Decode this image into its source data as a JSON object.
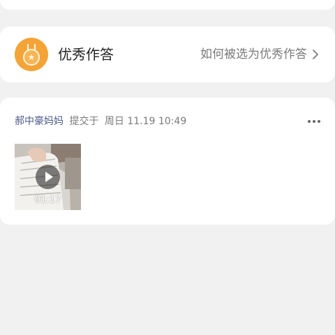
{
  "colors": {
    "page_background": "#f1f1f1",
    "card_background": "#ffffff",
    "medal": "#f4a437",
    "author_name": "#4b5a8a",
    "secondary_text": "#7a7a7a"
  },
  "excellent_section": {
    "icon": "medal-icon",
    "title": "优秀作答",
    "link_label": "如何被选为优秀作答"
  },
  "post": {
    "author": "郝中豪妈妈",
    "action": "提交于",
    "timestamp": "周日 11.19 10:49",
    "more_icon": "more-dots-icon",
    "attachment": {
      "type": "video",
      "duration": "01:17",
      "play_icon": "play-icon"
    }
  }
}
